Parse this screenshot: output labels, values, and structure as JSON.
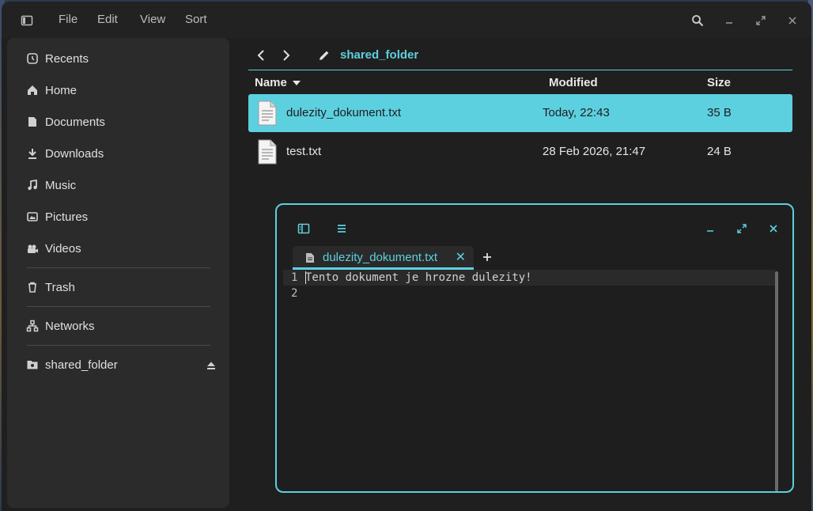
{
  "menubar": {
    "items": [
      "File",
      "Edit",
      "View",
      "Sort"
    ]
  },
  "sidebar": {
    "items": [
      {
        "label": "Recents",
        "icon": "recents-icon"
      },
      {
        "label": "Home",
        "icon": "home-icon"
      },
      {
        "label": "Documents",
        "icon": "documents-icon"
      },
      {
        "label": "Downloads",
        "icon": "downloads-icon"
      },
      {
        "label": "Music",
        "icon": "music-icon"
      },
      {
        "label": "Pictures",
        "icon": "pictures-icon"
      },
      {
        "label": "Videos",
        "icon": "videos-icon"
      },
      {
        "label": "Trash",
        "icon": "trash-icon"
      },
      {
        "label": "Networks",
        "icon": "networks-icon"
      },
      {
        "label": "shared_folder",
        "icon": "folder-icon"
      }
    ]
  },
  "location": {
    "path": "shared_folder"
  },
  "table": {
    "columns": [
      "Name",
      "Modified",
      "Size"
    ],
    "rows": [
      {
        "name": "dulezity_dokument.txt",
        "modified": "Today, 22:43",
        "size": "35 B",
        "selected": true
      },
      {
        "name": "test.txt",
        "modified": "28 Feb 2026, 21:47",
        "size": "24 B",
        "selected": false
      }
    ]
  },
  "editor": {
    "tab_title": "dulezity_dokument.txt",
    "lines": [
      {
        "number": "1",
        "text": "Tento dokument je hrozne dulezity!"
      },
      {
        "number": "2",
        "text": ""
      }
    ]
  },
  "colors": {
    "accent": "#5dd0e0",
    "window_bg": "#1f1f1f",
    "sidebar_bg": "#2b2b2b"
  }
}
